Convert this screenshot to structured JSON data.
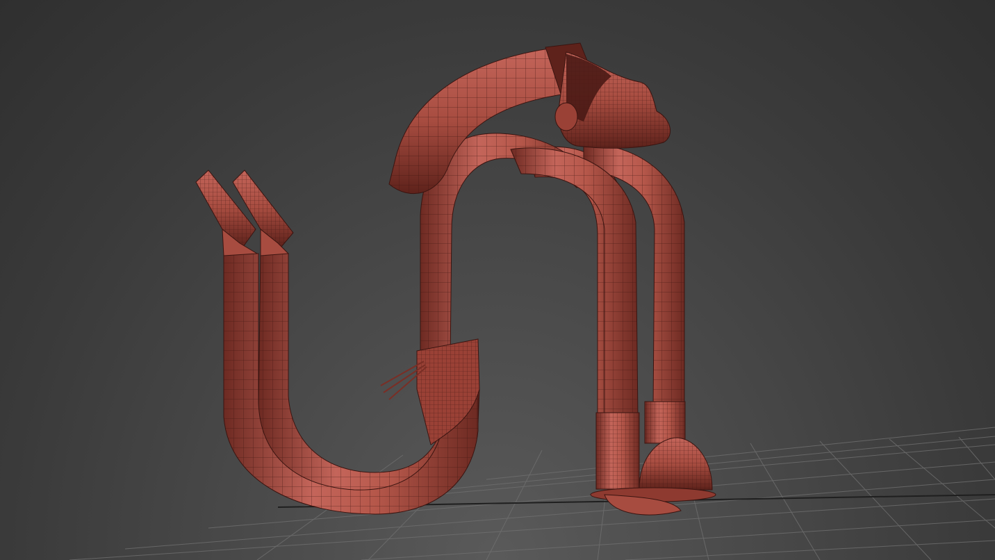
{
  "viewport": {
    "view": "perspective",
    "background_color": "#454545",
    "grid_color": "#6e6e6e",
    "grid_highlight_color": "#1f1f1f",
    "model": {
      "description_icon": "wireframe-mesh-icon",
      "mesh_color": "#b5574a",
      "mesh_shadow_color": "#6d2a22",
      "wire_color": "#3a1410"
    }
  }
}
